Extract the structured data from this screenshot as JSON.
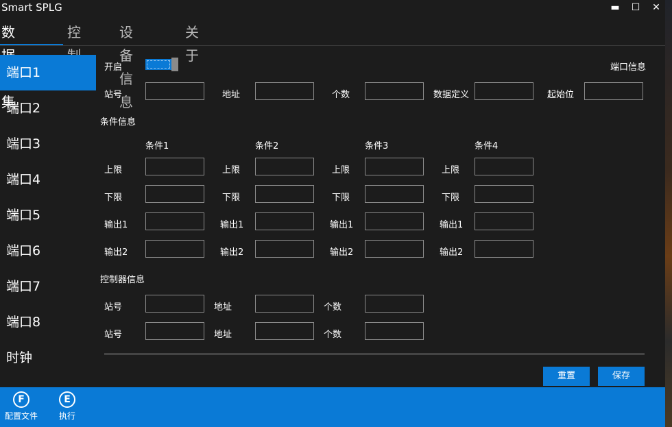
{
  "window": {
    "title": "Smart SPLG",
    "minimize": "▬",
    "maximize": "☐",
    "close": "✕"
  },
  "tabs": [
    "数据采集",
    "控制器",
    "设备信息",
    "关于"
  ],
  "sidebar": [
    "端口1",
    "端口2",
    "端口3",
    "端口4",
    "端口5",
    "端口6",
    "端口7",
    "端口8",
    "时钟"
  ],
  "port": {
    "enable_label": "开启",
    "enabled": true,
    "info_label": "端口信息",
    "fields": [
      "站号",
      "地址",
      "个数",
      "数据定义",
      "起始位"
    ]
  },
  "conditions": {
    "title": "条件信息",
    "headers": [
      "条件1",
      "条件2",
      "条件3",
      "条件4"
    ],
    "row_labels": [
      "上限",
      "下限",
      "输出1",
      "输出2"
    ]
  },
  "controller": {
    "title": "控制器信息",
    "fields": [
      "站号",
      "地址",
      "个数"
    ]
  },
  "buttons": {
    "reset": "重置",
    "save": "保存"
  },
  "commands": [
    {
      "icon": "F",
      "label": "配置文件"
    },
    {
      "icon": "E",
      "label": "执行"
    }
  ],
  "colors": {
    "accent": "#0a7ad6",
    "background": "#1c1c1c",
    "input_border": "#8d8d8d"
  }
}
